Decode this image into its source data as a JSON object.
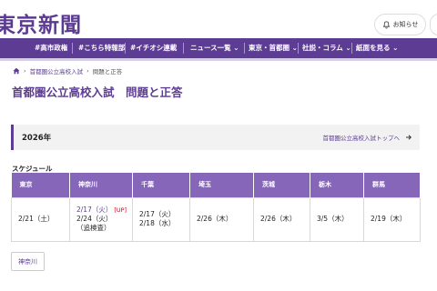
{
  "header": {
    "logo_text": "東京新聞",
    "notify_label": "お知らせ",
    "brand_color": "#5d3c94"
  },
  "nav": {
    "items": [
      "#高市政権",
      "#こちら特報部",
      "#イチオシ連載",
      "ニュース一覧",
      "東京・首都圏",
      "社説・コラム",
      "紙面を見る"
    ]
  },
  "breadcrumb": {
    "home_icon": "home-icon",
    "items": [
      "首都圏公立高校入試",
      "問題と正答"
    ]
  },
  "page": {
    "title": "首都圏公立高校入試　問題と正答",
    "year": "2026年",
    "top_link": "首都圏公立高校入試トップへ",
    "schedule_label": "スケジュール"
  },
  "schedule": {
    "headers": [
      "東京",
      "神奈川",
      "千葉",
      "埼玉",
      "茨城",
      "栃木",
      "群馬"
    ],
    "cells": [
      [
        "2/21（土）"
      ],
      [
        "2/17（火）",
        "2/24（火）",
        "（追検査）"
      ],
      [
        "2/17（火）",
        "2/18（水）"
      ],
      [
        "2/26（木）"
      ],
      [
        "2/26（木）"
      ],
      [
        "3/5（木）"
      ],
      [
        "2/19（木）"
      ]
    ],
    "up_badge": "[UP]"
  },
  "pref_button": "神奈川"
}
